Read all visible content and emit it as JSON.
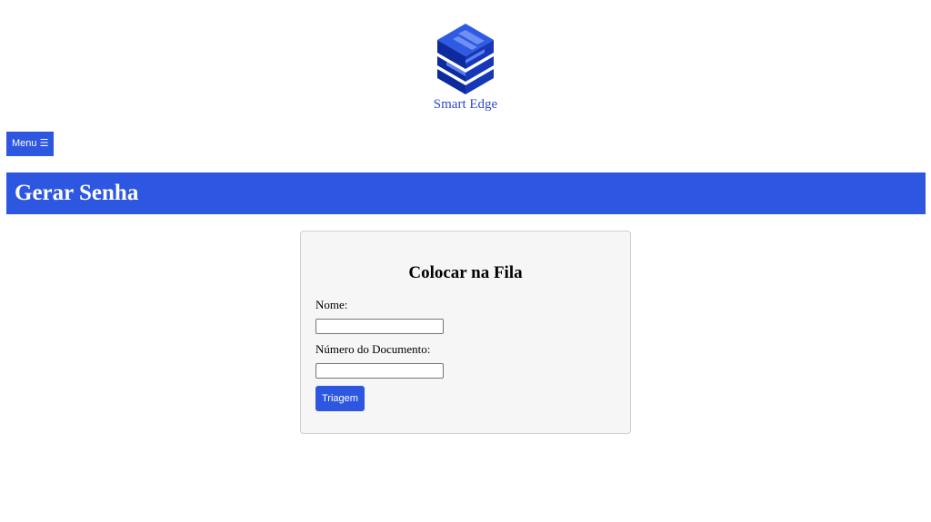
{
  "brand": {
    "name": "Smart Edge",
    "logo_icon": "stacked-cube-logo-icon",
    "color": "#2f49c9",
    "logo_dark": "#0d2a9e",
    "logo_light": "#5b7df0"
  },
  "nav": {
    "menu_label": "Menu ☰"
  },
  "header": {
    "title": "Gerar Senha",
    "color": "#2d57e0"
  },
  "form": {
    "title": "Colocar na Fila",
    "fields": [
      {
        "label": "Nome:",
        "value": "",
        "placeholder": ""
      },
      {
        "label": "Número do Documento:",
        "value": "",
        "placeholder": ""
      }
    ],
    "submit_label": "Triagem"
  }
}
